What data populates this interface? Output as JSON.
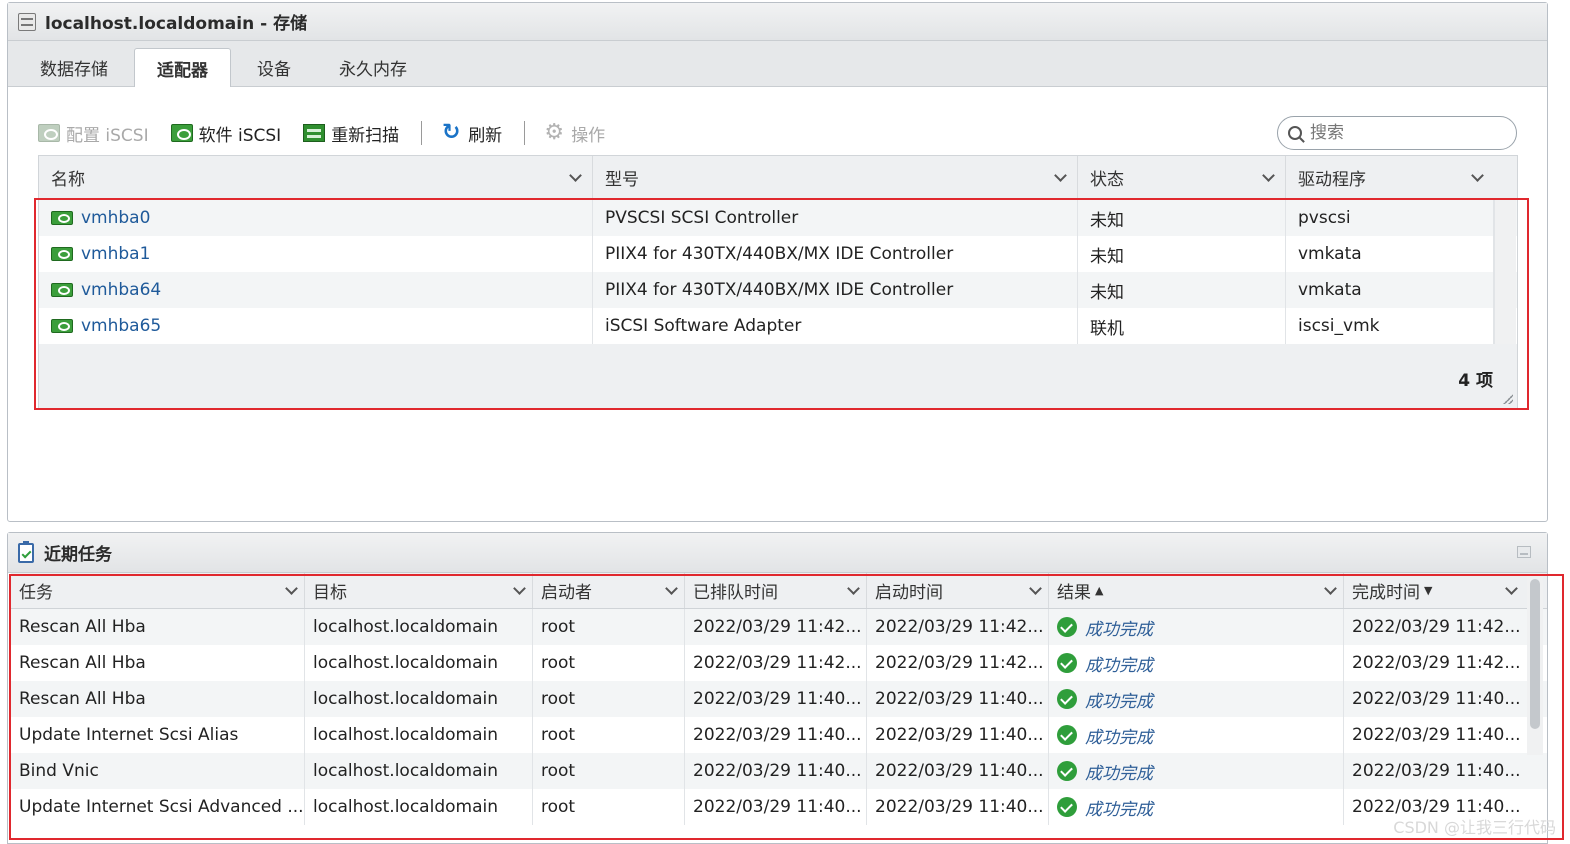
{
  "panel": {
    "title": "localhost.localdomain - 存储",
    "tabs": [
      {
        "label": "数据存储"
      },
      {
        "label": "适配器"
      },
      {
        "label": "设备"
      },
      {
        "label": "永久内存"
      }
    ]
  },
  "toolbar": {
    "configure_iscsi": "配置 iSCSI",
    "software_iscsi": "软件 iSCSI",
    "rescan": "重新扫描",
    "refresh": "刷新",
    "actions": "操作",
    "search_placeholder": "搜索"
  },
  "adapters": {
    "columns": [
      "名称",
      "型号",
      "状态",
      "驱动程序"
    ],
    "rows": [
      {
        "name": "vmhba0",
        "model": "PVSCSI SCSI Controller",
        "status": "未知",
        "driver": "pvscsi"
      },
      {
        "name": "vmhba1",
        "model": "PIIX4 for 430TX/440BX/MX IDE Controller",
        "status": "未知",
        "driver": "vmkata"
      },
      {
        "name": "vmhba64",
        "model": "PIIX4 for 430TX/440BX/MX IDE Controller",
        "status": "未知",
        "driver": "vmkata"
      },
      {
        "name": "vmhba65",
        "model": "iSCSI Software Adapter",
        "status": "联机",
        "driver": "iscsi_vmk"
      }
    ],
    "count": "4 项"
  },
  "tasks": {
    "title": "近期任务",
    "columns": [
      "任务",
      "目标",
      "启动者",
      "已排队时间",
      "启动时间",
      "结果",
      "完成时间"
    ],
    "sort_up": "▲",
    "sort_down": "▼",
    "rows": [
      {
        "task": "Rescan All Hba",
        "target": "localhost.localdomain",
        "initiator": "root",
        "queued": "2022/03/29 11:42...",
        "started": "2022/03/29 11:42...",
        "result": "成功完成",
        "completed": "2022/03/29 11:42..."
      },
      {
        "task": "Rescan All Hba",
        "target": "localhost.localdomain",
        "initiator": "root",
        "queued": "2022/03/29 11:42...",
        "started": "2022/03/29 11:42...",
        "result": "成功完成",
        "completed": "2022/03/29 11:42..."
      },
      {
        "task": "Rescan All Hba",
        "target": "localhost.localdomain",
        "initiator": "root",
        "queued": "2022/03/29 11:40...",
        "started": "2022/03/29 11:40...",
        "result": "成功完成",
        "completed": "2022/03/29 11:40..."
      },
      {
        "task": "Update Internet Scsi Alias",
        "target": "localhost.localdomain",
        "initiator": "root",
        "queued": "2022/03/29 11:40...",
        "started": "2022/03/29 11:40...",
        "result": "成功完成",
        "completed": "2022/03/29 11:40..."
      },
      {
        "task": "Bind Vnic",
        "target": "localhost.localdomain",
        "initiator": "root",
        "queued": "2022/03/29 11:40...",
        "started": "2022/03/29 11:40...",
        "result": "成功完成",
        "completed": "2022/03/29 11:40..."
      },
      {
        "task": "Update Internet Scsi Advanced ...",
        "target": "localhost.localdomain",
        "initiator": "root",
        "queued": "2022/03/29 11:40...",
        "started": "2022/03/29 11:40...",
        "result": "成功完成",
        "completed": "2022/03/29 11:40..."
      }
    ]
  },
  "watermark": "CSDN @让我三行代码",
  "colors": {
    "highlight": "#e0282e",
    "link": "#1f5a9a",
    "success": "#2f9e3b"
  }
}
